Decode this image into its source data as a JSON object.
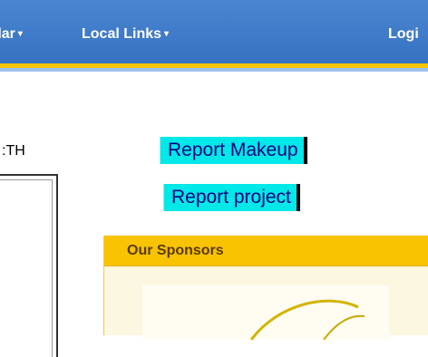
{
  "nav": {
    "items": [
      {
        "label": "dar"
      },
      {
        "label": "Local Links"
      },
      {
        "label": "Logi"
      }
    ],
    "caret": "▾"
  },
  "left": {
    "label": ":TH"
  },
  "buttons": {
    "makeup": "Report Makeup",
    "project": "Report project"
  },
  "sponsors": {
    "title": "Our Sponsors"
  },
  "colors": {
    "nav_bg": "#3c78c8",
    "nav_accent": "#f2c500",
    "button_bg": "#00e8e8",
    "sponsor_header": "#f8c300",
    "sponsor_bg": "#fbf7e0"
  }
}
